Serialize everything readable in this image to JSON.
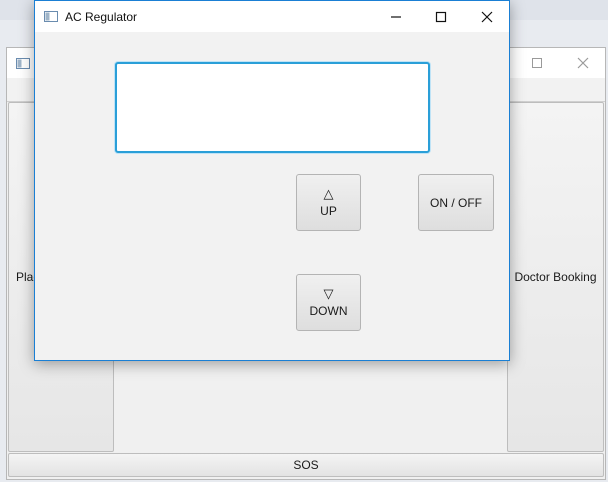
{
  "background_window": {
    "left_button_label": "Plac",
    "right_button_label": "Doctor Booking",
    "sos_label": "SOS"
  },
  "dialog": {
    "title": "AC Regulator",
    "display_text": "",
    "up_symbol": "△",
    "up_label": "UP",
    "down_symbol": "▽",
    "down_label": "DOWN",
    "onoff_label": "ON / OFF"
  },
  "icons": {
    "app_icon": "window-app-icon",
    "minimize": "minimize-icon",
    "maximize": "maximize-icon",
    "close": "close-icon"
  },
  "colors": {
    "focus_border": "#2a9fd8",
    "dialog_border": "#1a7fd4"
  }
}
